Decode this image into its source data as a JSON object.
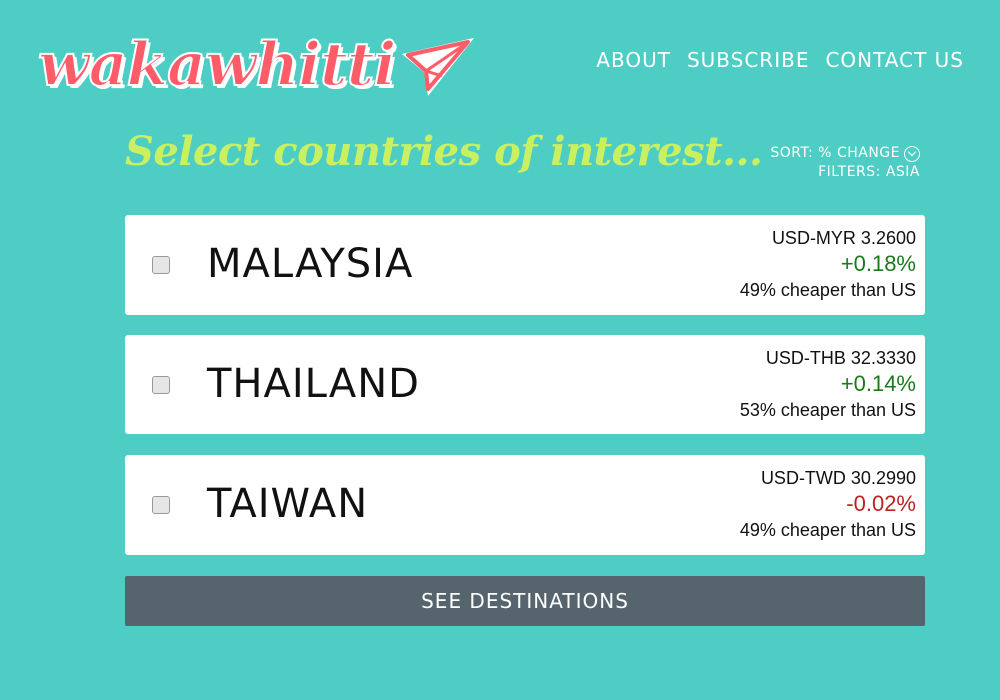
{
  "brand": {
    "logo_text": "wakawhitti",
    "logo_icon": "paper-plane-icon"
  },
  "nav": {
    "items": [
      {
        "label": "ABOUT"
      },
      {
        "label": "SUBSCRIBE"
      },
      {
        "label": "CONTACT US"
      }
    ]
  },
  "heading": "Select countries of interest...",
  "controls": {
    "sort_label": "SORT: % CHANGE",
    "filter_label": "FILTERS: ASIA"
  },
  "countries": [
    {
      "name": "MALAYSIA",
      "pair": "USD-MYR 3.2600",
      "change": "+0.18%",
      "direction": "up",
      "cheaper": "49% cheaper than US"
    },
    {
      "name": "THAILAND",
      "pair": "USD-THB 32.3330",
      "change": "+0.14%",
      "direction": "up",
      "cheaper": "53% cheaper than US"
    },
    {
      "name": "TAIWAN",
      "pair": "USD-TWD 30.2990",
      "change": "-0.02%",
      "direction": "down",
      "cheaper": "49% cheaper than US"
    }
  ],
  "cta": {
    "label": "SEE DESTINATIONS"
  },
  "colors": {
    "background": "#4ecdc4",
    "logo": "#ff5c6a",
    "heading": "#c8f060",
    "up": "#1c7a1c",
    "down": "#c02020",
    "button": "#56646e"
  }
}
